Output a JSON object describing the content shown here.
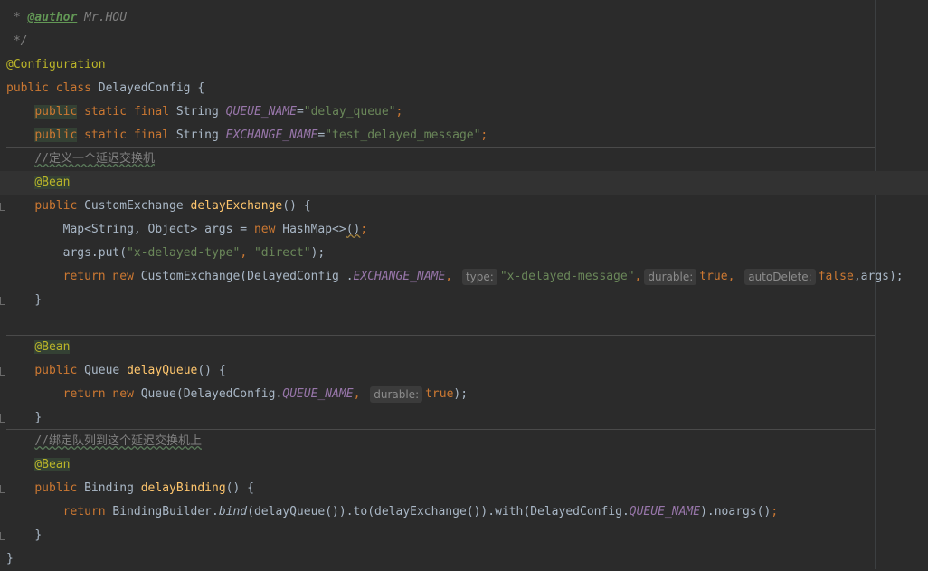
{
  "code": {
    "l1_prefix": " * ",
    "l1_tag": "@author",
    "l1_rest": " Mr.HOU",
    "l2": " */",
    "l3": "@Configuration",
    "l4_kw1": "public",
    "l4_kw2": " class ",
    "l4_rest": "DelayedConfig {",
    "l5_kw1": "public",
    "l5_kw2": " static final ",
    "l5_type": "String ",
    "l5_const": "QUEUE_NAME",
    "l5_eq": "=",
    "l5_str": "\"delay_queue\"",
    "l5_end": ";",
    "l6_kw1": "public",
    "l6_kw2": " static final ",
    "l6_type": "String ",
    "l6_const": "EXCHANGE_NAME",
    "l6_eq": "=",
    "l6_str": "\"test_delayed_message\"",
    "l6_end": ";",
    "l7_comment": "//定义一个延迟交换机",
    "l8_ann": "@Bean",
    "l9_kw": "public",
    "l9_type": " CustomExchange ",
    "l9_method": "delayExchange",
    "l9_end": "() {",
    "l10_a": "Map<String, Object> args = ",
    "l10_kw": "new",
    "l10_b": " HashMap<>",
    "l10_c": "()",
    "l10_d": ";",
    "l11_a": "args.put(",
    "l11_s1": "\"x-delayed-type\"",
    "l11_b": ", ",
    "l11_s2": "\"direct\"",
    "l11_c": ");",
    "l12_kw1": "return",
    "l12_kw2": " new",
    "l12_a": " CustomExchange(DelayedConfig .",
    "l12_const": "EXCHANGE_NAME",
    "l12_b": ", ",
    "l12_hint1": "type:",
    "l12_s1": "\"x-delayed-message\"",
    "l12_c": ",",
    "l12_hint2": "durable:",
    "l12_v1": "true",
    "l12_d": ", ",
    "l12_hint3": "autoDelete:",
    "l12_v2": "false",
    "l12_e": ",args);",
    "l13": "}",
    "l15_ann": "@Bean",
    "l16_kw": "public",
    "l16_type": " Queue ",
    "l16_method": "delayQueue",
    "l16_end": "() {",
    "l17_kw1": "return",
    "l17_kw2": " new",
    "l17_a": " Queue(DelayedConfig.",
    "l17_const": "QUEUE_NAME",
    "l17_b": ", ",
    "l17_hint": "durable:",
    "l17_v": "true",
    "l17_c": ");",
    "l18": "}",
    "l19_comment": "//绑定队列到这个延迟交换机上",
    "l20_ann": "@Bean",
    "l21_kw": "public",
    "l21_type": " Binding ",
    "l21_method": "delayBinding",
    "l21_end": "() {",
    "l22_kw": "return",
    "l22_a": " BindingBuilder.",
    "l22_bind": "bind",
    "l22_b": "(delayQueue()).to(delayExchange()).with(DelayedConfig.",
    "l22_const": "QUEUE_NAME",
    "l22_c": ").noargs()",
    "l22_d": ";",
    "l23": "}",
    "l24": "}"
  }
}
